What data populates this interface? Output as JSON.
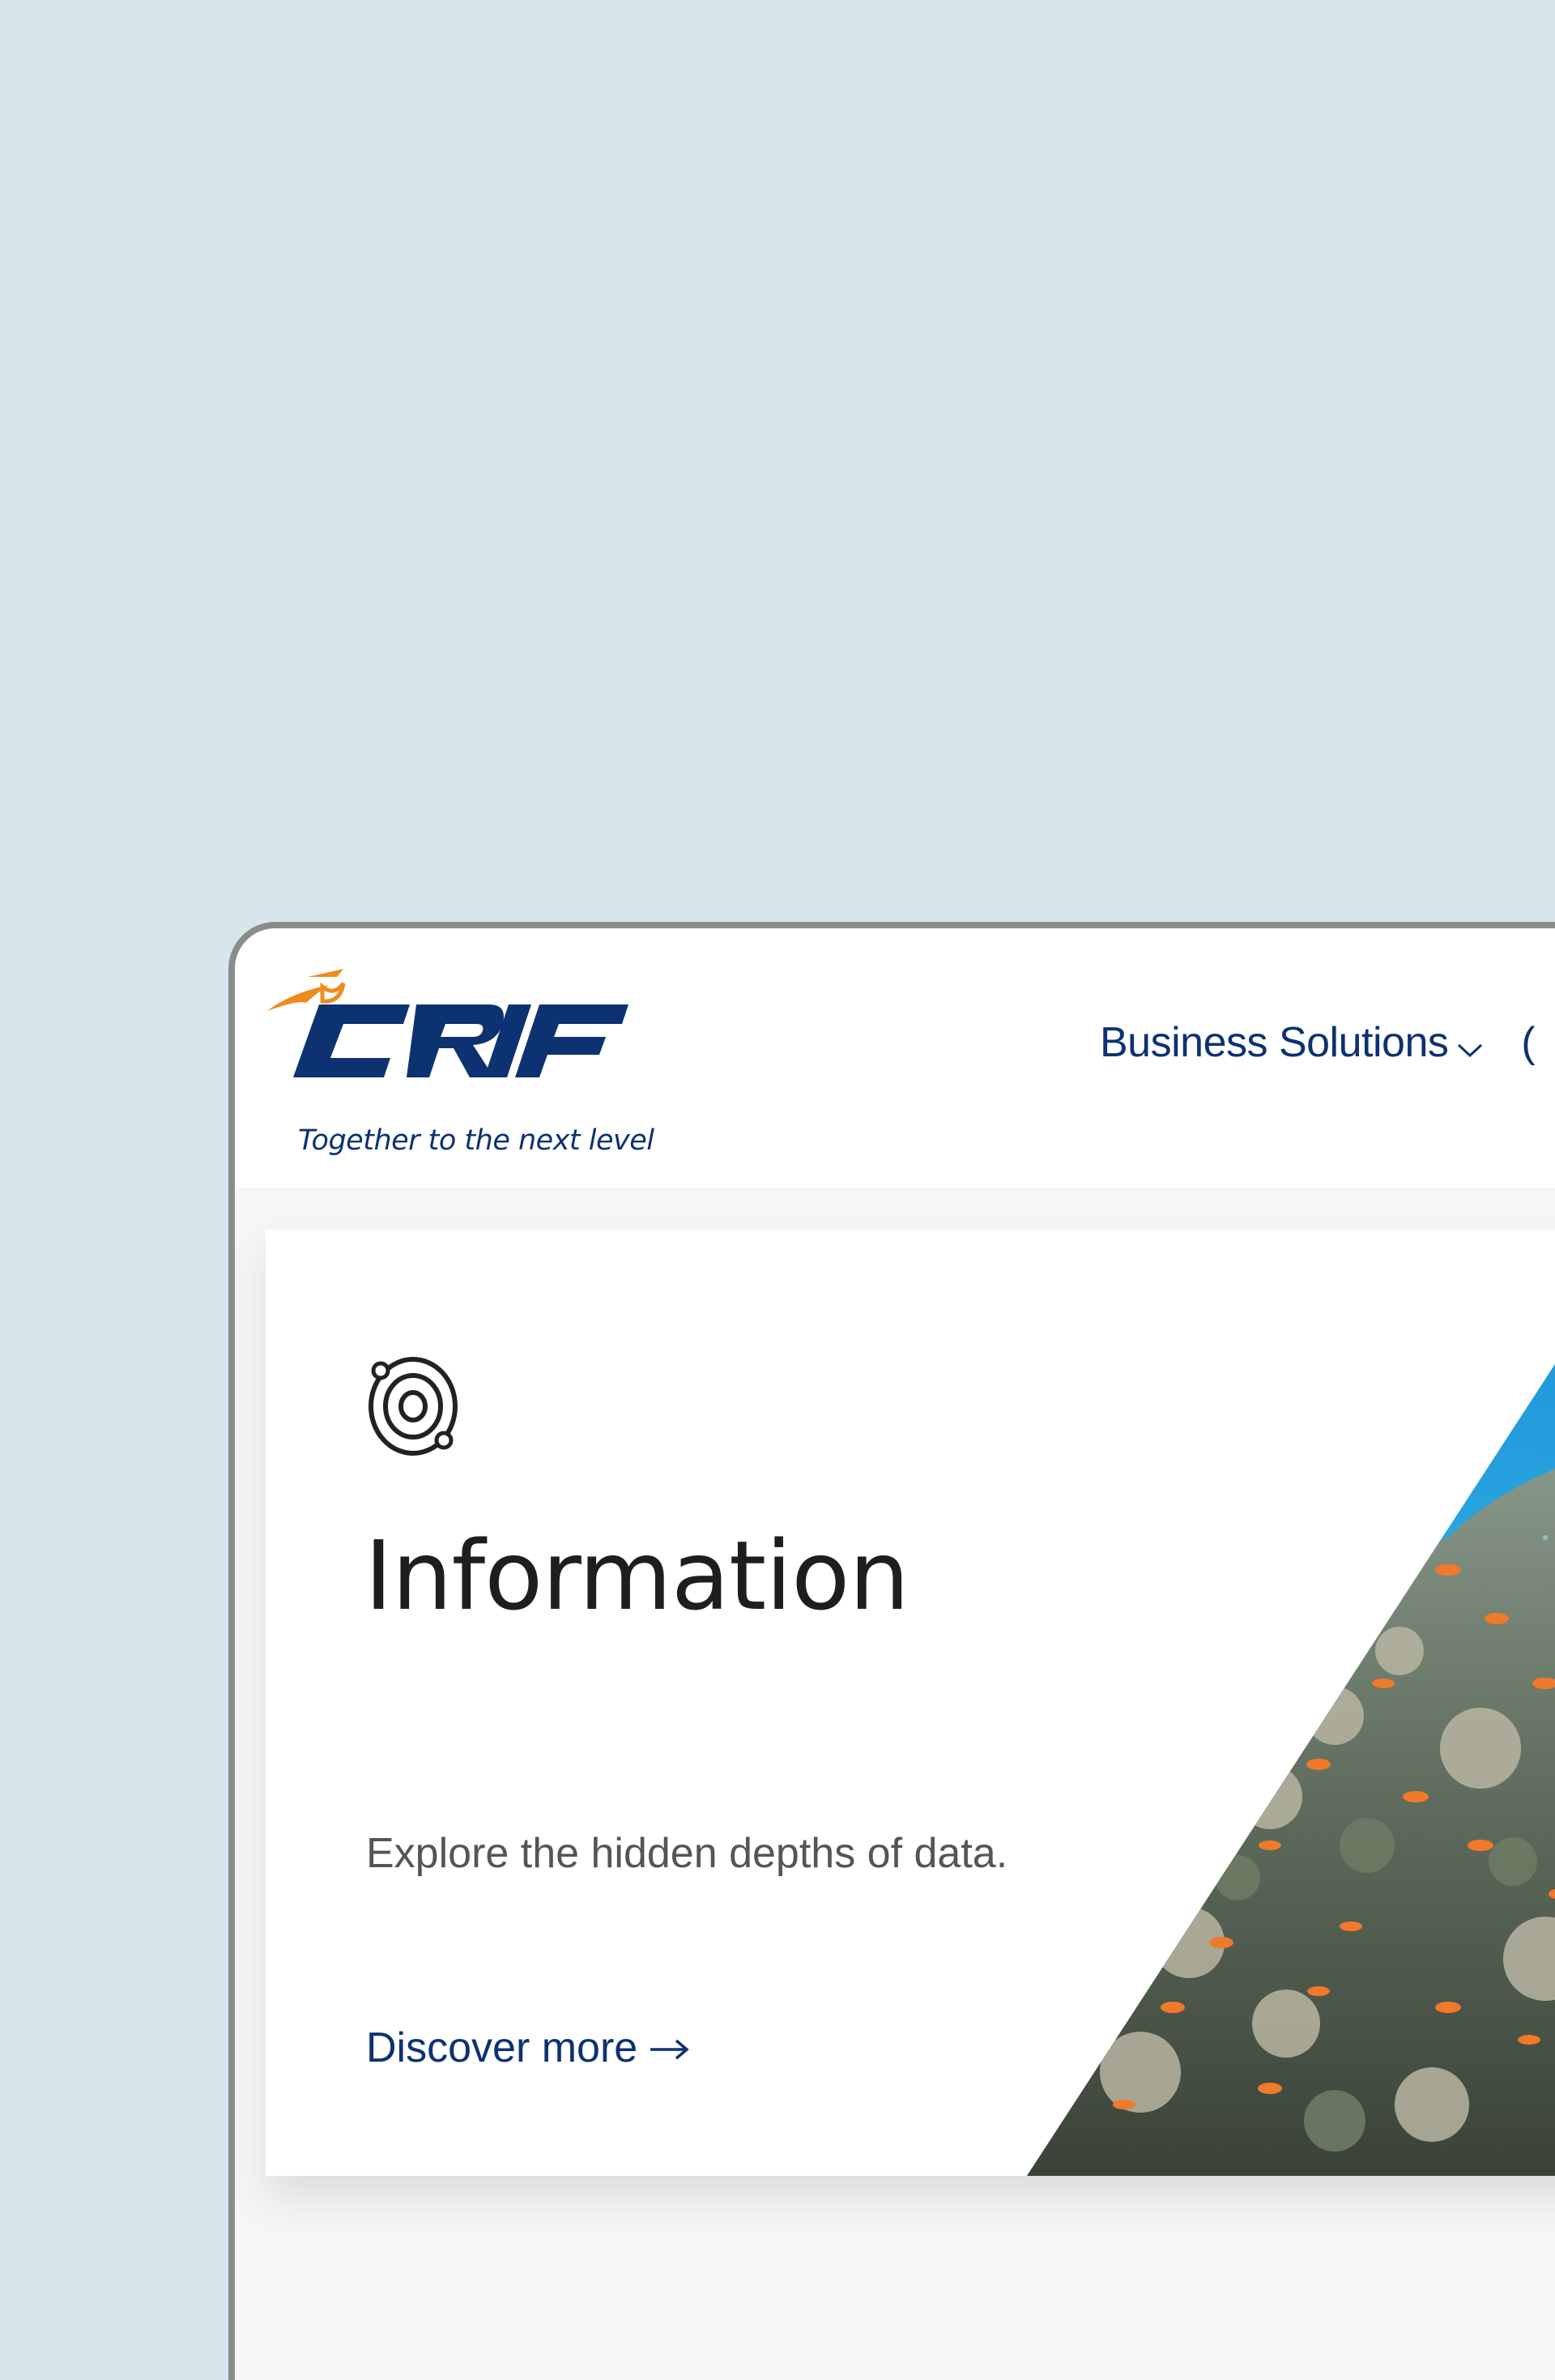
{
  "brand": {
    "name": "CRIF",
    "tagline": "Together to the next level",
    "colors": {
      "primary": "#0d3272",
      "accent": "#f08a1f"
    }
  },
  "nav": {
    "items": [
      {
        "label": "Business Solutions",
        "icon": "chevron-down-icon"
      }
    ],
    "partial_next": "("
  },
  "hero": {
    "icon": "orbit-icon",
    "title": "Information",
    "description": "Explore the hidden depths of data.",
    "cta_label": "Discover more",
    "cta_icon": "arrow-right-icon",
    "image": "coral-reef-image"
  }
}
